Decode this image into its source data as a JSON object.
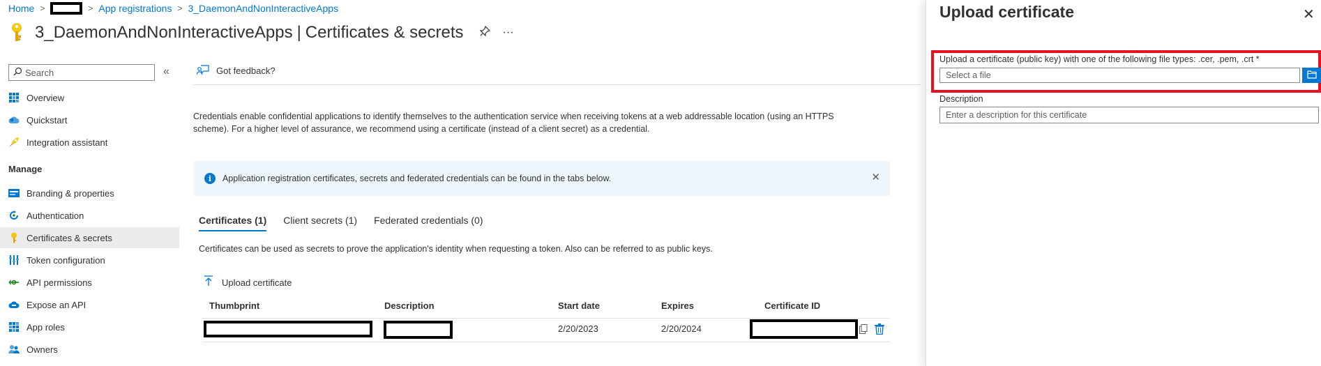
{
  "breadcrumb": {
    "home": "Home",
    "app_registrations": "App registrations",
    "app": "3_DaemonAndNonInteractiveApps"
  },
  "header": {
    "app_name": "3_DaemonAndNonInteractiveApps",
    "separator": "|",
    "page": "Certificates & secrets",
    "more": "···"
  },
  "sidebar": {
    "search_placeholder": "Search",
    "collapse": "«",
    "items_top": [
      {
        "label": "Overview",
        "icon": "grid-icon"
      },
      {
        "label": "Quickstart",
        "icon": "cloud-icon"
      },
      {
        "label": "Integration assistant",
        "icon": "rocket-icon"
      }
    ],
    "section": "Manage",
    "items_manage": [
      {
        "label": "Branding & properties",
        "icon": "card-icon"
      },
      {
        "label": "Authentication",
        "icon": "refresh-icon"
      },
      {
        "label": "Certificates & secrets",
        "icon": "key-icon",
        "active": true
      },
      {
        "label": "Token configuration",
        "icon": "bars-icon"
      },
      {
        "label": "API permissions",
        "icon": "arrows-icon"
      },
      {
        "label": "Expose an API",
        "icon": "cloud-api-icon"
      },
      {
        "label": "App roles",
        "icon": "apps-icon"
      },
      {
        "label": "Owners",
        "icon": "people-icon"
      }
    ]
  },
  "toolbar": {
    "feedback": "Got feedback?"
  },
  "intro_text": "Credentials enable confidential applications to identify themselves to the authentication service when receiving tokens at a web addressable location (using an HTTPS scheme). For a higher level of assurance, we recommend using a certificate (instead of a client secret) as a credential.",
  "info_bar": {
    "text": "Application registration certificates, secrets and federated credentials can be found in the tabs below."
  },
  "tabs": [
    {
      "label": "Certificates (1)",
      "active": true
    },
    {
      "label": "Client secrets (1)",
      "active": false
    },
    {
      "label": "Federated credentials (0)",
      "active": false
    }
  ],
  "tab_description": "Certificates can be used as secrets to prove the application's identity when requesting a token. Also can be referred to as public keys.",
  "upload_command": "Upload certificate",
  "table": {
    "headers": [
      "Thumbprint",
      "Description",
      "Start date",
      "Expires",
      "Certificate ID"
    ],
    "rows": [
      {
        "start_date": "2/20/2023",
        "expires": "2/20/2024"
      }
    ]
  },
  "panel": {
    "title": "Upload certificate",
    "close": "✕",
    "file_label": "Upload a certificate (public key) with one of the following file types: .cer, .pem, .crt *",
    "file_placeholder": "Select a file",
    "description_label": "Description",
    "description_placeholder": "Enter a description for this certificate"
  },
  "colors": {
    "accent": "#0078d4",
    "highlight_border": "#e81123",
    "active_nav_bg": "#edebe9",
    "info_bg": "#eff6fc"
  }
}
